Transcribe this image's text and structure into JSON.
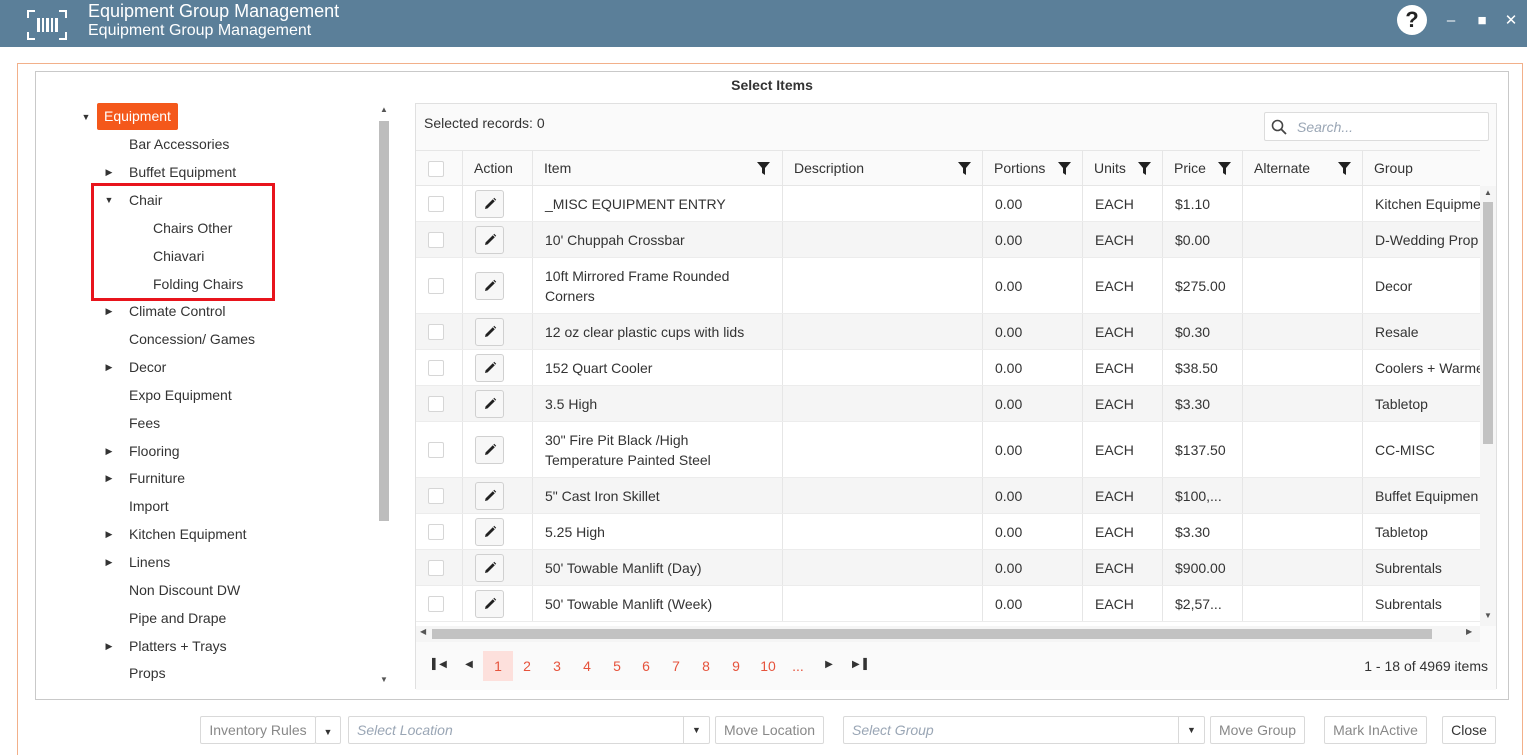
{
  "window": {
    "title": "Equipment Group Management",
    "subtitle": "Equipment Group Management",
    "help_icon": "?",
    "minimize_icon": "minimize-icon",
    "maximize_icon": "maximize-icon",
    "close_icon": "close-icon"
  },
  "dialog": {
    "title": "Select Items"
  },
  "tree": {
    "root": "Equipment",
    "items": [
      {
        "label": "Bar Accessories",
        "expandable": false,
        "level": 1
      },
      {
        "label": "Buffet Equipment",
        "expandable": true,
        "level": 1
      },
      {
        "label": "Chair",
        "expandable": true,
        "expanded": true,
        "level": 1
      },
      {
        "label": "Chairs Other",
        "expandable": false,
        "level": 2
      },
      {
        "label": "Chiavari",
        "expandable": false,
        "level": 2
      },
      {
        "label": "Folding Chairs",
        "expandable": false,
        "level": 2
      },
      {
        "label": "Climate Control",
        "expandable": true,
        "level": 1
      },
      {
        "label": "Concession/ Games",
        "expandable": false,
        "level": 1
      },
      {
        "label": "Decor",
        "expandable": true,
        "level": 1
      },
      {
        "label": "Expo Equipment",
        "expandable": false,
        "level": 1
      },
      {
        "label": "Fees",
        "expandable": false,
        "level": 1
      },
      {
        "label": "Flooring",
        "expandable": true,
        "level": 1
      },
      {
        "label": "Furniture",
        "expandable": true,
        "level": 1
      },
      {
        "label": "Import",
        "expandable": false,
        "level": 1
      },
      {
        "label": "Kitchen Equipment",
        "expandable": true,
        "level": 1
      },
      {
        "label": "Linens",
        "expandable": true,
        "level": 1
      },
      {
        "label": "Non Discount DW",
        "expandable": false,
        "level": 1
      },
      {
        "label": "Pipe and Drape",
        "expandable": false,
        "level": 1
      },
      {
        "label": "Platters + Trays",
        "expandable": true,
        "level": 1
      },
      {
        "label": "Props",
        "expandable": false,
        "level": 1
      }
    ]
  },
  "grid": {
    "selected_records": "Selected records: 0",
    "search_placeholder": "Search...",
    "columns": [
      "Action",
      "Item",
      "Description",
      "Portions",
      "Units",
      "Price",
      "Alternate",
      "Group"
    ],
    "rows": [
      {
        "item": "_MISC EQUIPMENT ENTRY",
        "description": "",
        "portions": "0.00",
        "units": "EACH",
        "price": "$1.10",
        "alternate": "",
        "group": "Kitchen Equipme"
      },
      {
        "item": "10' Chuppah Crossbar",
        "description": "",
        "portions": "0.00",
        "units": "EACH",
        "price": "$0.00",
        "alternate": "",
        "group": "D-Wedding Prop"
      },
      {
        "item": "10ft Mirrored Frame Rounded Corners",
        "description": "",
        "portions": "0.00",
        "units": "EACH",
        "price": "$275.00",
        "alternate": "",
        "group": "Decor"
      },
      {
        "item": "12 oz clear plastic cups with lids",
        "description": "",
        "portions": "0.00",
        "units": "EACH",
        "price": "$0.30",
        "alternate": "",
        "group": "Resale"
      },
      {
        "item": "152 Quart Cooler",
        "description": "",
        "portions": "0.00",
        "units": "EACH",
        "price": "$38.50",
        "alternate": "",
        "group": "Coolers + Warme"
      },
      {
        "item": "3.5 High",
        "description": "",
        "portions": "0.00",
        "units": "EACH",
        "price": "$3.30",
        "alternate": "",
        "group": "Tabletop"
      },
      {
        "item": "30\" Fire Pit Black /High Temperature Painted Steel",
        "description": "",
        "portions": "0.00",
        "units": "EACH",
        "price": "$137.50",
        "alternate": "",
        "group": "CC-MISC"
      },
      {
        "item": "5\" Cast Iron Skillet",
        "description": "",
        "portions": "0.00",
        "units": "EACH",
        "price": "$100,...",
        "alternate": "",
        "group": "Buffet Equipmen"
      },
      {
        "item": "5.25 High",
        "description": "",
        "portions": "0.00",
        "units": "EACH",
        "price": "$3.30",
        "alternate": "",
        "group": "Tabletop"
      },
      {
        "item": "50' Towable Manlift (Day)",
        "description": "",
        "portions": "0.00",
        "units": "EACH",
        "price": "$900.00",
        "alternate": "",
        "group": "Subrentals"
      },
      {
        "item": "50' Towable Manlift (Week)",
        "description": "",
        "portions": "0.00",
        "units": "EACH",
        "price": "$2,57...",
        "alternate": "",
        "group": "Subrentals"
      }
    ],
    "pager": {
      "pages": [
        "1",
        "2",
        "3",
        "4",
        "5",
        "6",
        "7",
        "8",
        "9",
        "10",
        "..."
      ],
      "current": "1",
      "info": "1 - 18 of 4969 items"
    }
  },
  "footer": {
    "inventory_rules": "Inventory Rules",
    "select_location_placeholder": "Select Location",
    "move_location": "Move Location",
    "select_group_placeholder": "Select Group",
    "move_group": "Move Group",
    "mark_inactive": "Mark InActive",
    "close": "Close"
  },
  "colors": {
    "titlebar": "#5b7f99",
    "selected_node": "#f4581b",
    "highlight_box": "#e8141c",
    "pager_accent": "#e6533c"
  }
}
